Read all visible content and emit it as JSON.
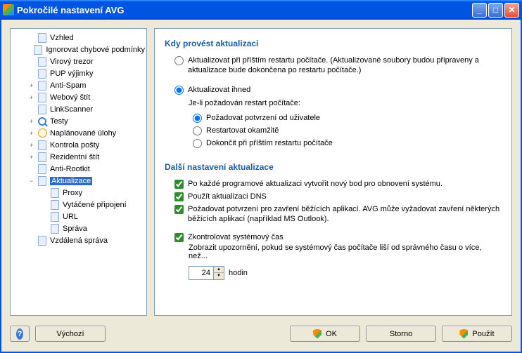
{
  "window": {
    "title": "Pokročilé nastavení AVG"
  },
  "tree": {
    "items": [
      {
        "label": "Vzhled",
        "icon": "page",
        "exp": ""
      },
      {
        "label": "Ignorovat chybové podmínky",
        "icon": "page",
        "exp": ""
      },
      {
        "label": "Virový trezor",
        "icon": "page",
        "exp": ""
      },
      {
        "label": "PUP výjimky",
        "icon": "page",
        "exp": ""
      },
      {
        "label": "Anti-Spam",
        "icon": "page",
        "exp": "+"
      },
      {
        "label": "Webový štít",
        "icon": "page",
        "exp": "+"
      },
      {
        "label": "LinkScanner",
        "icon": "page",
        "exp": ""
      },
      {
        "label": "Testy",
        "icon": "mag",
        "exp": "+"
      },
      {
        "label": "Naplánované úlohy",
        "icon": "clock",
        "exp": "+"
      },
      {
        "label": "Kontrola pošty",
        "icon": "page",
        "exp": "+"
      },
      {
        "label": "Rezidentní štít",
        "icon": "page",
        "exp": "+"
      },
      {
        "label": "Anti-Rootkit",
        "icon": "page",
        "exp": ""
      },
      {
        "label": "Aktualizace",
        "icon": "page",
        "exp": "−",
        "selected": true
      },
      {
        "label": "Proxy",
        "icon": "page",
        "exp": "",
        "indent": 2
      },
      {
        "label": "Vytáčené připojení",
        "icon": "page",
        "exp": "",
        "indent": 2
      },
      {
        "label": "URL",
        "icon": "page",
        "exp": "",
        "indent": 2
      },
      {
        "label": "Správa",
        "icon": "page",
        "exp": "",
        "indent": 2
      },
      {
        "label": "Vzdálená správa",
        "icon": "page",
        "exp": ""
      }
    ]
  },
  "content": {
    "section1_title": "Kdy provést aktualizaci",
    "opt_restart": "Aktualizovat při příštím restartu počítače. (Aktualizované soubory budou připraveny a aktualizace bude dokončena po restartu počítače.)",
    "opt_now": "Aktualizovat ihned",
    "sub_desc": "Je-li požadován restart počítače:",
    "sub1": "Požadovat potvrzení od uživatele",
    "sub2": "Restartovat okamžitě",
    "sub3": "Dokončit při příštím restartu počítače",
    "section2_title": "Další nastavení aktualizace",
    "chk1": "Po každé programové aktualizaci vytvořit nový bod pro obnovení systému.",
    "chk2": "Použít aktualizaci DNS",
    "chk3": "Požadovat potvrzení pro zavření běžících aplikací. AVG může vyžadovat zavření některých běžících aplikací (například MS Outlook).",
    "chk4": "Zkontrolovat systémový čas",
    "chk4_desc": "Zobrazit upozornění, pokud se systémový čas počítače liší od správného času o více, než...",
    "hours_value": "24",
    "hours_unit": "hodin"
  },
  "footer": {
    "default": "Výchozí",
    "ok": "OK",
    "cancel": "Storno",
    "apply": "Použít"
  }
}
